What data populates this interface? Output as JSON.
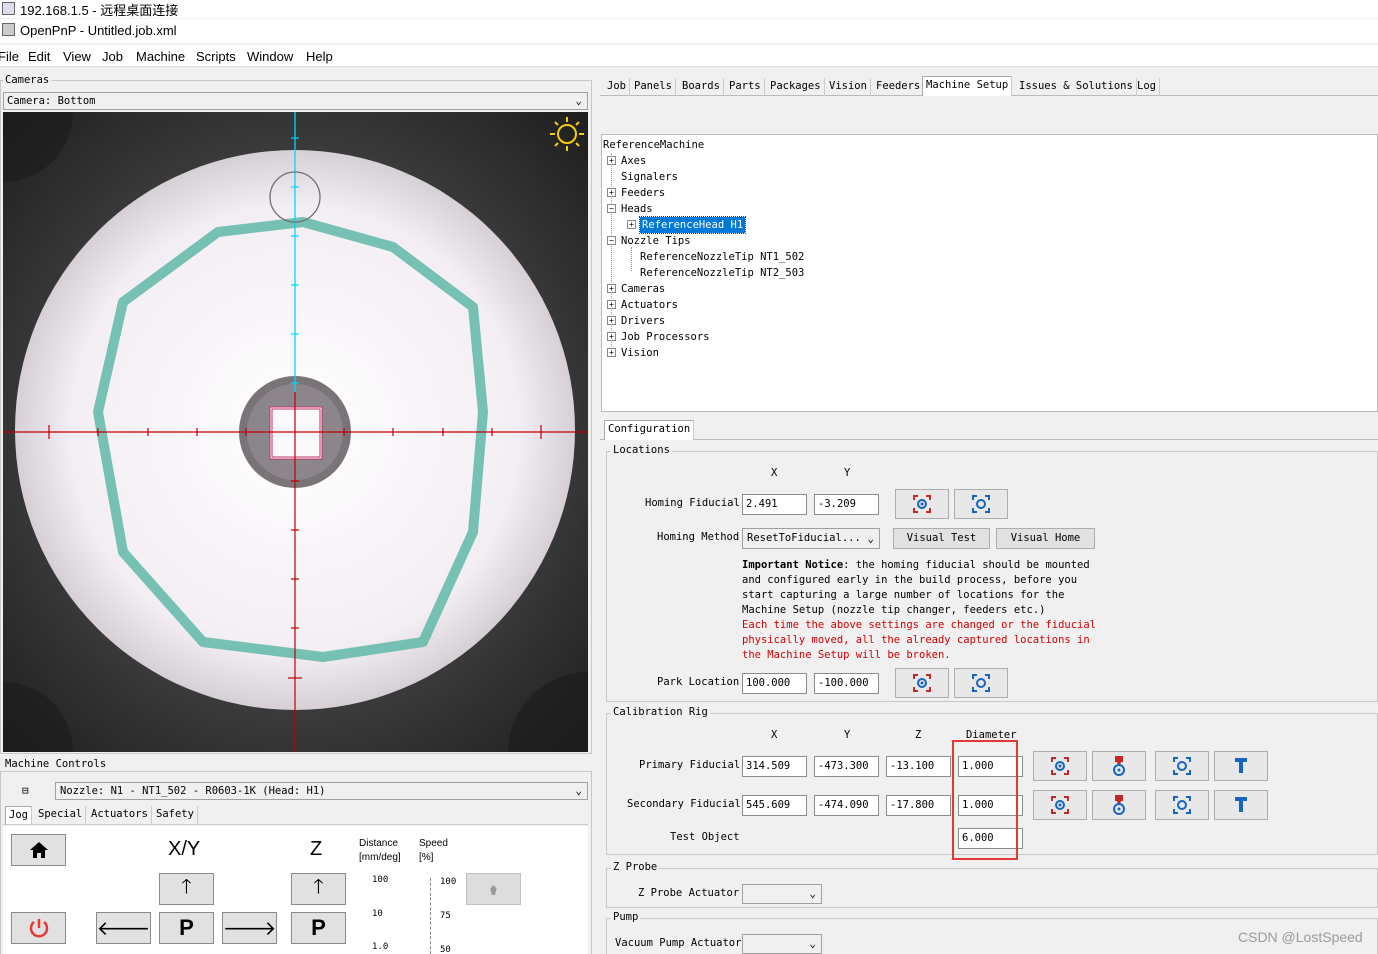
{
  "rdp": {
    "title": "192.168.1.5 - 远程桌面连接"
  },
  "app": {
    "title": "OpenPnP - Untitled.job.xml"
  },
  "menu": [
    "File",
    "Edit",
    "View",
    "Job",
    "Machine",
    "Scripts",
    "Window",
    "Help"
  ],
  "cameras": {
    "legend": "Cameras",
    "selected": "Camera: Bottom"
  },
  "machine_controls": {
    "legend": "Machine Controls",
    "nozzle": "Nozzle: N1 - NT1_502 - R0603-1K (Head: H1)",
    "tabs": [
      "Jog",
      "Special",
      "Actuators",
      "Safety"
    ],
    "xy_label": "X/Y",
    "z_label": "Z",
    "distance_label": "Distance",
    "distance_unit": "[mm/deg]",
    "speed_label": "Speed",
    "speed_unit": "[%]",
    "distance_ticks": [
      "100",
      "10",
      "1.0"
    ],
    "speed_ticks": [
      "100",
      "75",
      "50"
    ],
    "park_label": "P"
  },
  "right_tabs": [
    "Job",
    "Panels",
    "Boards",
    "Parts",
    "Packages",
    "Vision",
    "Feeders",
    "Machine Setup",
    "Issues & Solutions",
    "Log"
  ],
  "tree": {
    "root": "ReferenceMachine",
    "items": [
      "Axes",
      "Signalers",
      "Feeders",
      "Heads",
      "ReferenceHead H1",
      "Nozzle Tips",
      "ReferenceNozzleTip NT1_502",
      "ReferenceNozzleTip NT2_503",
      "Cameras",
      "Actuators",
      "Drivers",
      "Job Processors",
      "Vision"
    ]
  },
  "config": {
    "tab": "Configuration",
    "locations": {
      "legend": "Locations",
      "x_header": "X",
      "y_header": "Y",
      "homing_fiducial_label": "Homing Fiducial",
      "homing_fiducial_x": "2.491",
      "homing_fiducial_y": "-3.209",
      "homing_method_label": "Homing Method",
      "homing_method_value": "ResetToFiducial...",
      "visual_test": "Visual Test",
      "visual_home": "Visual Home",
      "notice_bold": "Important Notice",
      "notice_lines": [
        ": the homing fiducial should be mounted",
        "and configured early in the build process, before you",
        "start capturing a large number of locations for the",
        "Machine Setup (nozzle tip changer, feeders etc.)"
      ],
      "warning_lines": [
        "Each time the above settings are changed or the fiducial",
        "physically moved, all the already captured locations in",
        "the Machine Setup will be broken."
      ],
      "park_label": "Park Location",
      "park_x": "100.000",
      "park_y": "-100.000"
    },
    "calibration": {
      "legend": "Calibration Rig",
      "x_header": "X",
      "y_header": "Y",
      "z_header": "Z",
      "diameter_header": "Diameter",
      "primary_label": "Primary Fiducial",
      "primary_x": "314.509",
      "primary_y": "-473.300",
      "primary_z": "-13.100",
      "primary_d": "1.000",
      "secondary_label": "Secondary Fiducial",
      "secondary_x": "545.609",
      "secondary_y": "-474.090",
      "secondary_z": "-17.800",
      "secondary_d": "1.000",
      "test_label": "Test Object",
      "test_d": "6.000"
    },
    "zprobe": {
      "legend": "Z Probe",
      "label": "Z Probe Actuator"
    },
    "pump": {
      "legend": "Pump",
      "label": "Vacuum Pump Actuator"
    }
  },
  "watermark": "CSDN @LostSpeed",
  "colors": {
    "accent_red": "#e53935",
    "selection_blue": "#0078d7",
    "crosshair_cyan": "#00d8ff",
    "crosshair_red": "#c00000"
  }
}
